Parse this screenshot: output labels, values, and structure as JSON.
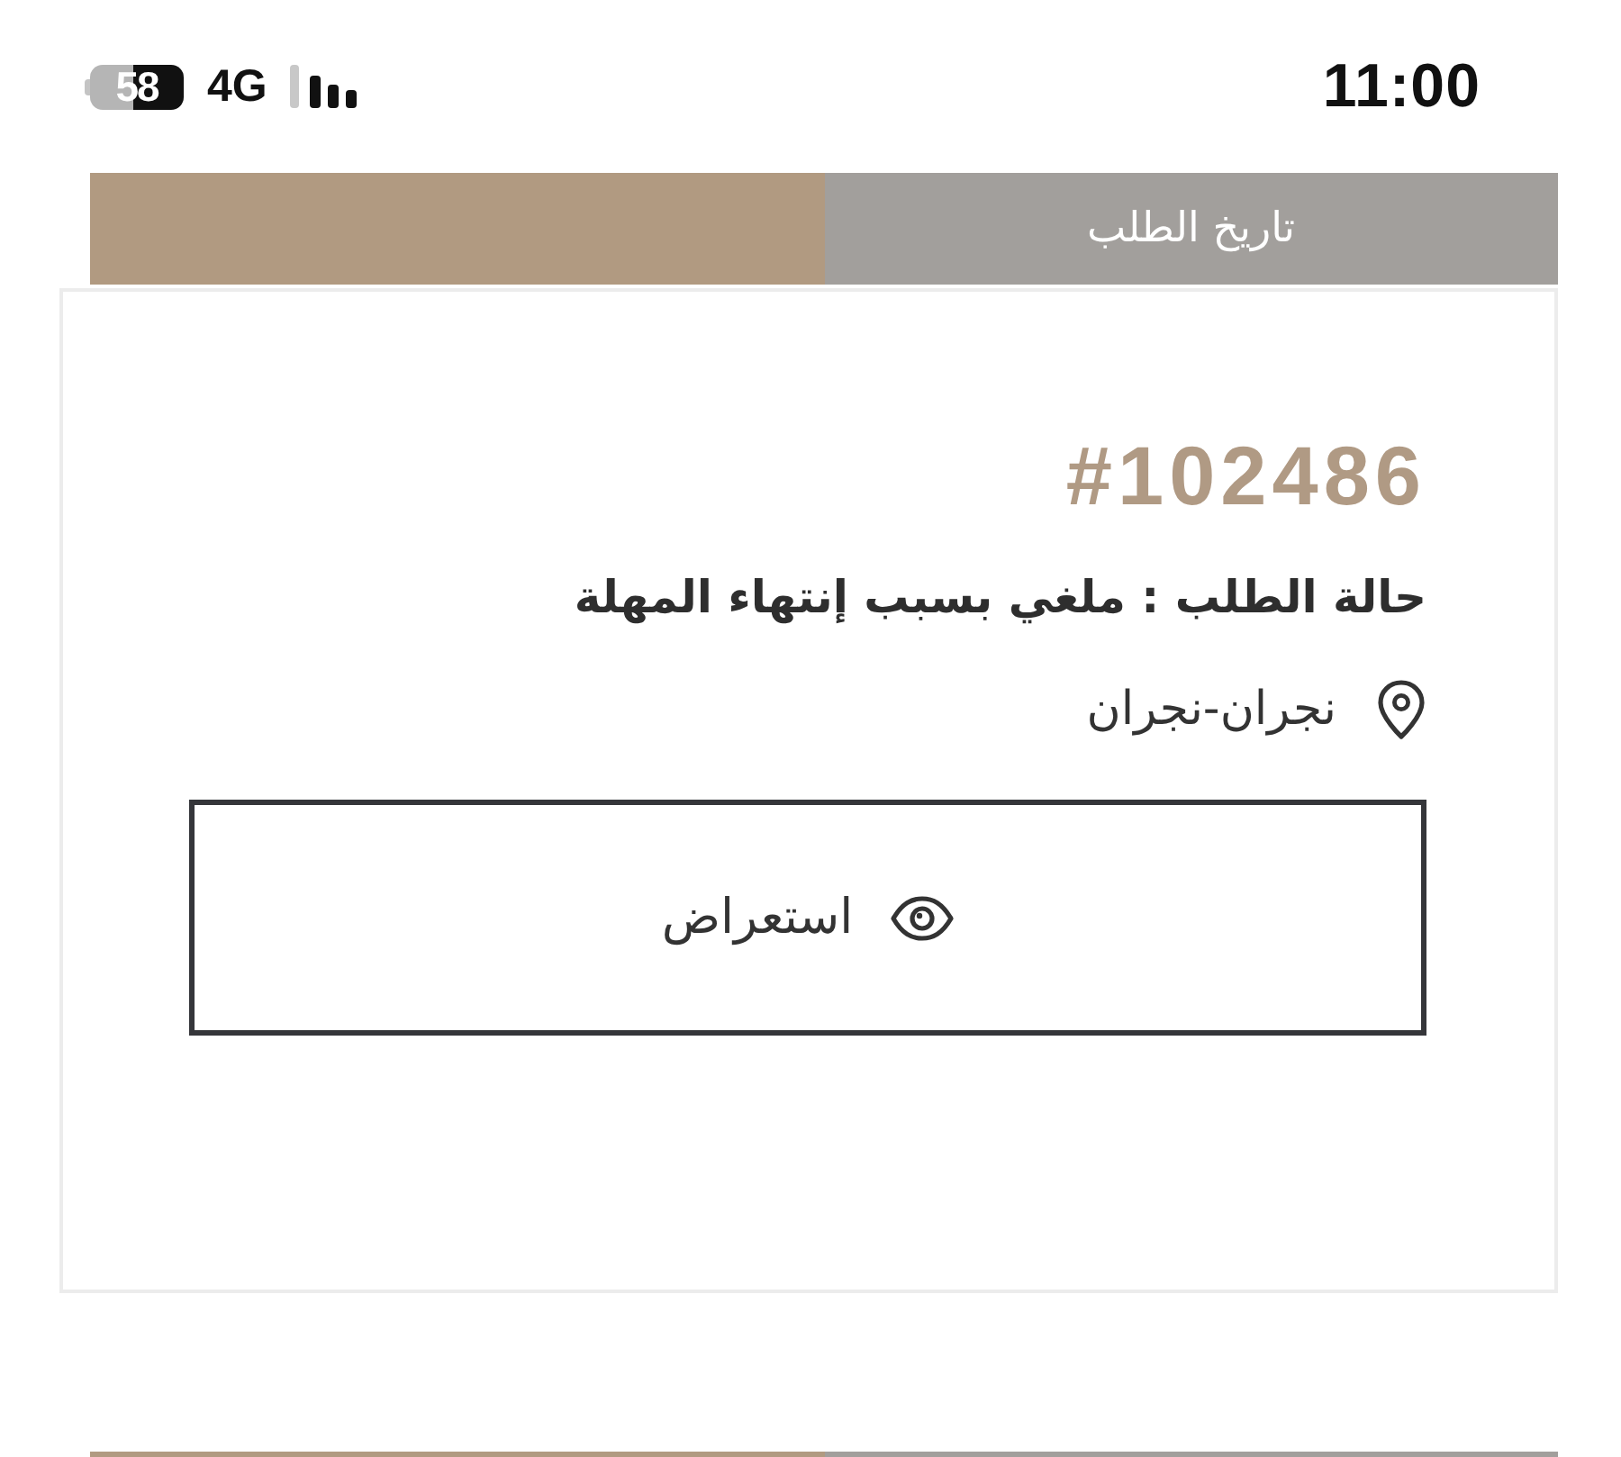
{
  "status_bar": {
    "battery": "58",
    "network": "4G",
    "time": "11:00"
  },
  "tabs": [
    {
      "label": "تاريخ الطلب",
      "selected": false
    },
    {
      "selected": true
    }
  ],
  "order": {
    "number": "#102486",
    "status": "حالة الطلب : ملغي بسبب إنتهاء المهلة",
    "location": "نجران-نجران",
    "view_button": "استعراض"
  },
  "next_card": {
    "tabs": [
      {
        "selected": false
      },
      {
        "selected": true
      }
    ]
  }
}
